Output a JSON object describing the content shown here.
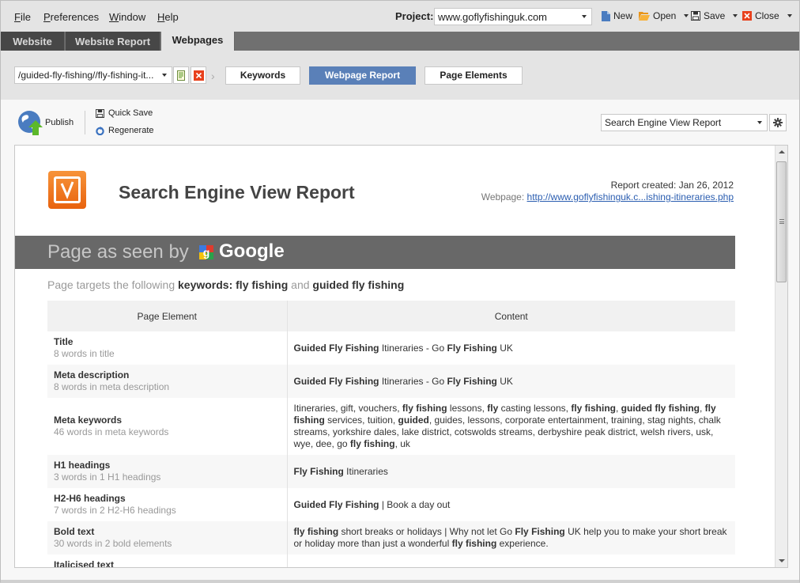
{
  "menu": {
    "items": [
      {
        "label": "File",
        "accel": "F",
        "rest": "ile"
      },
      {
        "label": "Preferences",
        "accel": "P",
        "rest": "references"
      },
      {
        "label": "Window",
        "accel": "W",
        "rest": "indow"
      },
      {
        "label": "Help",
        "accel": "H",
        "rest": "elp"
      }
    ]
  },
  "project": {
    "label": "Project:",
    "value": "www.goflyfishinguk.com"
  },
  "toolbar": {
    "new_label": "New",
    "open_label": "Open",
    "save_label": "Save",
    "close_label": "Close"
  },
  "tabs": [
    {
      "label": "Website"
    },
    {
      "label": "Website Report"
    },
    {
      "label": "Webpages",
      "active": true
    }
  ],
  "subbar": {
    "url_value": "/guided-fly-fishing//fly-fishing-it...",
    "nav_buttons": [
      {
        "label": "Keywords"
      },
      {
        "label": "Webpage Report",
        "active": true
      },
      {
        "label": "Page Elements"
      }
    ]
  },
  "actions": {
    "publish_label": "Publish",
    "quick_save_label": "Quick Save",
    "regenerate_label": "Regenerate",
    "report_type_value": "Search Engine View Report"
  },
  "report": {
    "title": "Search Engine View Report",
    "created": "Report created: Jan 26, 2012",
    "webpage_label": "Webpage: ",
    "webpage_link": "http://www.goflyfishinguk.c...ishing-itineraries.php",
    "banner_text": "Page as seen by",
    "banner_engine": "Google",
    "keywords_intro": "Page targets the following",
    "keywords_label": "keywords:",
    "keyword_1": "fly fishing",
    "keywords_and": "and",
    "keyword_2": "guided fly fishing",
    "table_headers": [
      "Page Element",
      "Content"
    ],
    "rows": [
      {
        "name": "Title",
        "sub": "8 words in title",
        "content": [
          [
            "b",
            "Guided Fly Fishing"
          ],
          [
            "t",
            " Itineraries - Go "
          ],
          [
            "b",
            "Fly Fishing"
          ],
          [
            "t",
            " UK"
          ]
        ]
      },
      {
        "name": "Meta description",
        "sub": "8 words in meta description",
        "content": [
          [
            "b",
            "Guided Fly Fishing"
          ],
          [
            "t",
            " Itineraries - Go "
          ],
          [
            "b",
            "Fly Fishing"
          ],
          [
            "t",
            " UK"
          ]
        ]
      },
      {
        "name": "Meta keywords",
        "sub": "46 words in meta keywords",
        "content": [
          [
            "t",
            "Itineraries, gift, vouchers, "
          ],
          [
            "b",
            "fly fishing"
          ],
          [
            "t",
            " lessons, "
          ],
          [
            "b",
            "fly"
          ],
          [
            "t",
            " casting lessons, "
          ],
          [
            "b",
            "fly fishing"
          ],
          [
            "t",
            ", "
          ],
          [
            "b",
            "guided fly fishing"
          ],
          [
            "t",
            ", "
          ],
          [
            "b",
            "fly fishing"
          ],
          [
            "t",
            " services, tuition, "
          ],
          [
            "b",
            "guided"
          ],
          [
            "t",
            ", guides, lessons, corporate entertainment, training, stag nights, chalk streams, yorkshire dales, lake district, cotswolds streams, derbyshire peak district, welsh rivers, usk, wye, dee, go "
          ],
          [
            "b",
            "fly fishing"
          ],
          [
            "t",
            ", uk"
          ]
        ]
      },
      {
        "name": "H1 headings",
        "sub": "3 words in 1 H1 headings",
        "content": [
          [
            "b",
            "Fly Fishing"
          ],
          [
            "t",
            " Itineraries"
          ]
        ]
      },
      {
        "name": "H2-H6 headings",
        "sub": "7 words in 2 H2-H6 headings",
        "content": [
          [
            "b",
            "Guided Fly Fishing"
          ],
          [
            "t",
            " | Book a day out"
          ]
        ]
      },
      {
        "name": "Bold text",
        "sub": "30 words in 2 bold elements",
        "content": [
          [
            "b",
            "fly fishing"
          ],
          [
            "t",
            " short breaks or holidays | Why not let Go "
          ],
          [
            "b",
            "Fly Fishing"
          ],
          [
            "t",
            " UK help you to make your short break or holiday more than just a wonderful "
          ],
          [
            "b",
            "fly fishing"
          ],
          [
            "t",
            " experience."
          ]
        ]
      },
      {
        "name": "Italicised text",
        "sub": "",
        "content": []
      }
    ]
  },
  "colors": {
    "accent_blue": "#5a80b8",
    "tab_dark": "#474747",
    "banner_gray": "#686868",
    "logo_orange": "#f07b22",
    "link_blue": "#2a5db0"
  }
}
